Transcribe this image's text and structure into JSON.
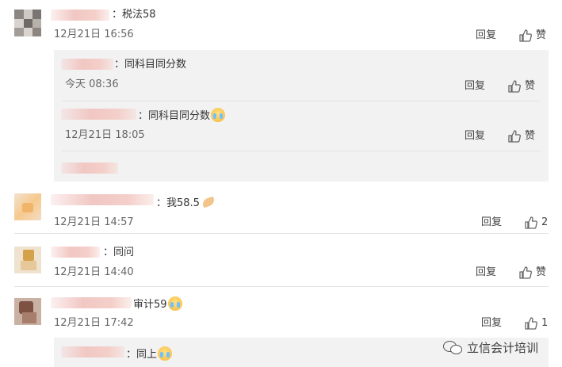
{
  "comments": [
    {
      "text": "：税法58",
      "time": "12月21日 16:56",
      "reply": "回复",
      "like": "赞"
    },
    {
      "text": "：同科目同分数",
      "time": "今天 08:36",
      "reply": "回复",
      "like": "赞"
    },
    {
      "text": "：同科目同分数",
      "time": "12月21日 18:05",
      "reply": "回复",
      "like": "赞"
    },
    {
      "text": "：我58.5",
      "time": "12月21日 14:57",
      "reply": "回复",
      "like": "2"
    },
    {
      "text": "：同问",
      "time": "12月21日 14:40",
      "reply": "回复",
      "like": "赞"
    },
    {
      "text": "审计59",
      "time": "12月21日 17:42",
      "reply": "回复",
      "like": "1"
    },
    {
      "text": "：同上"
    }
  ],
  "watermark": "立信会计培训",
  "icons": {
    "like": "thumbs-up-icon",
    "crying": "crying-emoji-icon",
    "clap": "clapping-hands-emoji-icon",
    "wechat": "wechat-icon"
  }
}
